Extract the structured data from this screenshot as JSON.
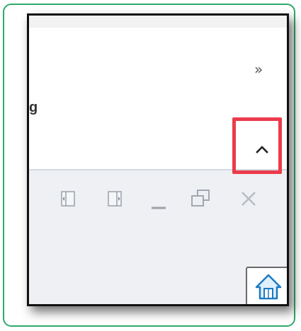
{
  "ribbon": {
    "overflow_icon": "double-chevron-right-icon",
    "overflow_glyph": "»",
    "partial_label": "g",
    "collapse_icon": "chevron-up-icon"
  },
  "window_controls": {
    "items": [
      "dock-left-icon",
      "dock-right-icon",
      "minimize-icon",
      "restore-icon",
      "close-icon"
    ]
  },
  "taskbar": {
    "home_icon": "home-icon"
  },
  "colors": {
    "highlight_border": "#ec3b4b",
    "outer_frame": "#2eaa6a",
    "home_accent": "#1a7ac4"
  }
}
